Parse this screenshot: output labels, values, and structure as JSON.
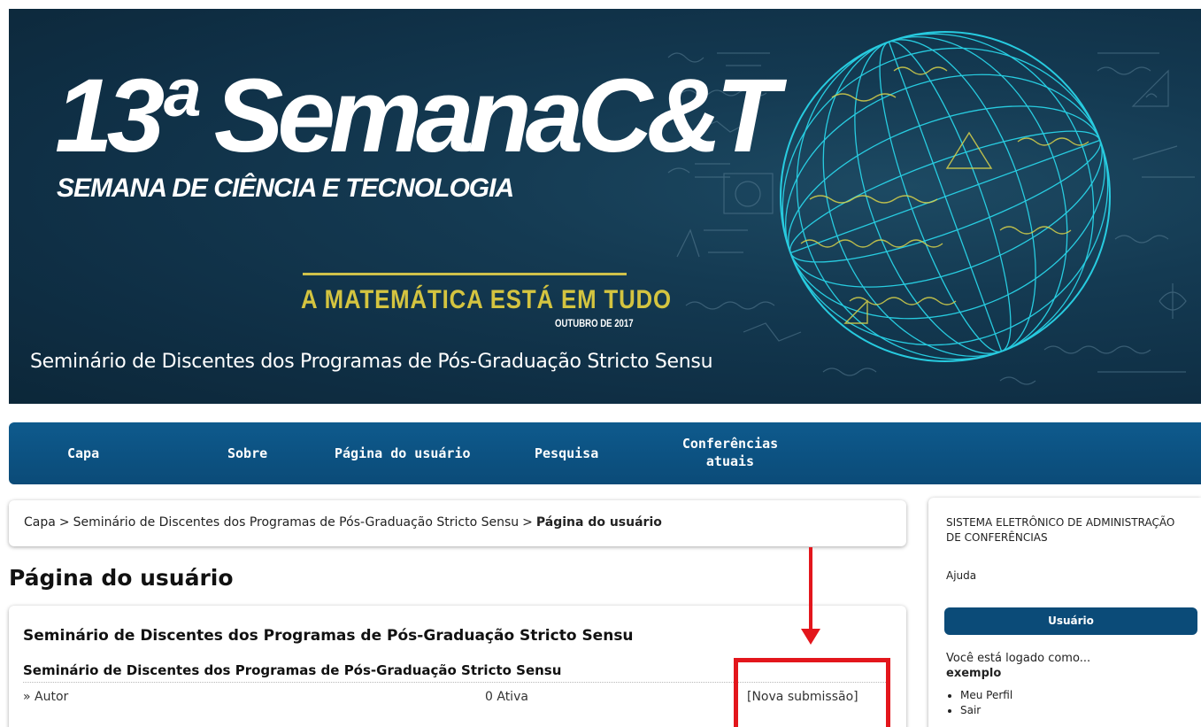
{
  "banner": {
    "title": "13ª SemanaC&T",
    "subtitle": "SEMANA DE CIÊNCIA E TECNOLOGIA",
    "tagline": "A MATEMÁTICA ESTÁ EM TUDO",
    "tagline_date": "OUTUBRO DE 2017",
    "conference_name": "Seminário de Discentes dos Programas de Pós-Graduação Stricto Sensu"
  },
  "nav": {
    "items": [
      {
        "label": "Capa"
      },
      {
        "label": "Sobre"
      },
      {
        "label": "Página do usuário"
      },
      {
        "label": "Pesquisa"
      },
      {
        "label": "Conferências\natuais"
      }
    ]
  },
  "breadcrumb": {
    "home": "Capa",
    "separator": ">",
    "conference": "Seminário de Discentes dos Programas de Pós-Graduação Stricto Sensu",
    "current": "Página do usuário"
  },
  "page_title": "Página do usuário",
  "content": {
    "heading": "Seminário de Discentes dos Programas de Pós-Graduação Stricto Sensu",
    "subheading": "Seminário de Discentes dos Programas de Pós-Graduação Stricto Sensu",
    "role_label": "» Autor",
    "active_count": "0 Ativa",
    "new_submission": "[Nova submissão]"
  },
  "sidebar": {
    "system_title": "SISTEMA ELETRÔNICO DE ADMINISTRAÇÃO DE CONFERÊNCIAS",
    "help": "Ajuda",
    "user_block_title": "Usuário",
    "logged_in_as": "Você está logado como...",
    "username": "exemplo",
    "links": [
      "Meu Perfil",
      "Sair"
    ]
  },
  "colors": {
    "banner_bg": "#0f2f45",
    "nav_bg": "#0b4b78",
    "tagline": "#d4c440",
    "sphere": "#29d4e8",
    "annotation": "#e3161c"
  }
}
